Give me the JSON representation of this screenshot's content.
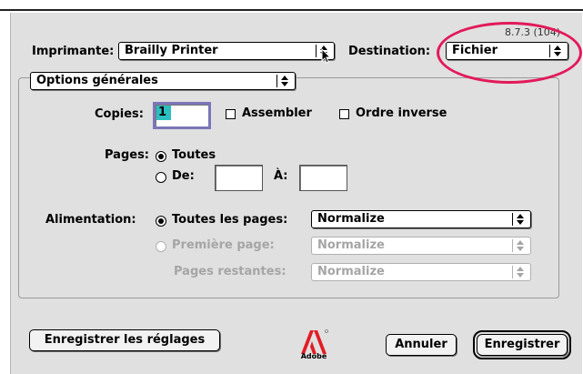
{
  "version": "8.7.3 (104)",
  "printer": {
    "label": "Imprimante:",
    "value": "Brailly Printer"
  },
  "destination": {
    "label": "Destination:",
    "value": "Fichier"
  },
  "section_popup": "Options générales",
  "copies": {
    "label": "Copies:",
    "value": "1",
    "assembler_label": "Assembler",
    "ordre_inverse_label": "Ordre inverse"
  },
  "pages": {
    "label": "Pages:",
    "all_label": "Toutes",
    "from_label": "De:",
    "to_label": "À:",
    "from_value": "",
    "to_value": ""
  },
  "feed": {
    "label": "Alimentation:",
    "all_pages_label": "Toutes les pages:",
    "all_pages_value": "Normalize",
    "first_page_label": "Première page:",
    "first_page_value": "Normalize",
    "remaining_label": "Pages restantes:",
    "remaining_value": "Normalize"
  },
  "buttons": {
    "save_settings": "Enregistrer les réglages",
    "cancel": "Annuler",
    "save": "Enregistrer"
  },
  "logo": {
    "text": "Adobe",
    "color": "#e31c23"
  },
  "annotation_color": "#e2195b"
}
